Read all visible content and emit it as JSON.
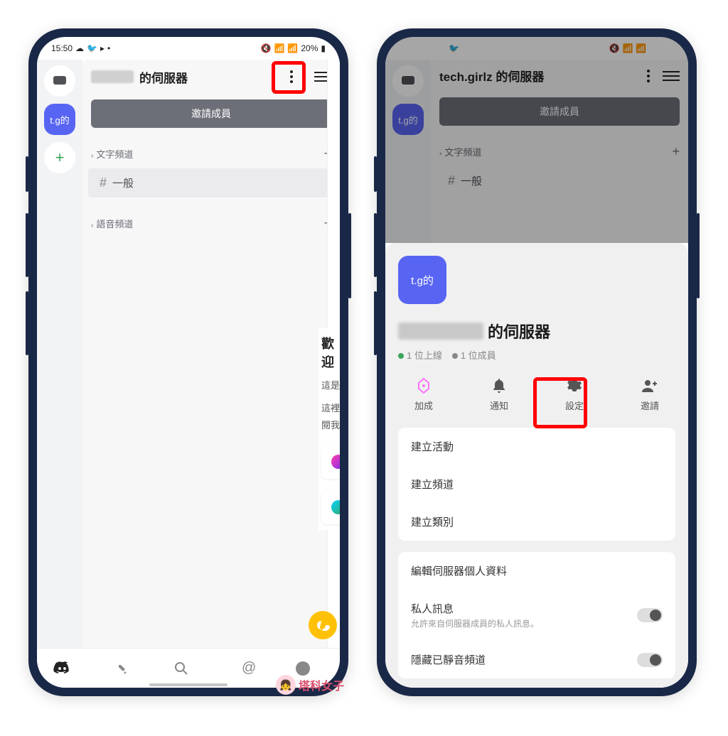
{
  "status_bar": {
    "time": "15:50",
    "battery": "20%"
  },
  "left_phone": {
    "server_rail": {
      "server_icon_text": "t.g的",
      "add_label": "+"
    },
    "header": {
      "title_suffix": "的伺服器"
    },
    "invite_button": "邀請成員",
    "categories": {
      "text_channels": "文字頻道",
      "voice_channels": "語音頻道"
    },
    "channel_general": "一般",
    "content_peek": {
      "welcome": "歡迎",
      "line1": "這是",
      "line2": "這裡",
      "line3": "閱我"
    }
  },
  "right_phone": {
    "bg_header": {
      "server_name": "tech.girlz 的伺服器",
      "invite_button": "邀請成員",
      "text_channels": "文字頻道",
      "channel_general": "一般"
    },
    "sheet": {
      "avatar_text": "t.g的",
      "title_suffix": "的伺服器",
      "online": "1 位上線",
      "members": "1 位成員",
      "actions": {
        "boost": "加成",
        "notifications": "通知",
        "settings": "設定",
        "invite": "邀請"
      },
      "group1": {
        "create_event": "建立活動",
        "create_channel": "建立頻道",
        "create_category": "建立類別"
      },
      "group2": {
        "edit_profile": "編輯伺服器個人資料",
        "dm_title": "私人訊息",
        "dm_sub": "允許來自伺服器成員的私人訊息。",
        "hide_muted": "隱藏已靜音頻道"
      }
    }
  },
  "watermark": "塔科女子"
}
